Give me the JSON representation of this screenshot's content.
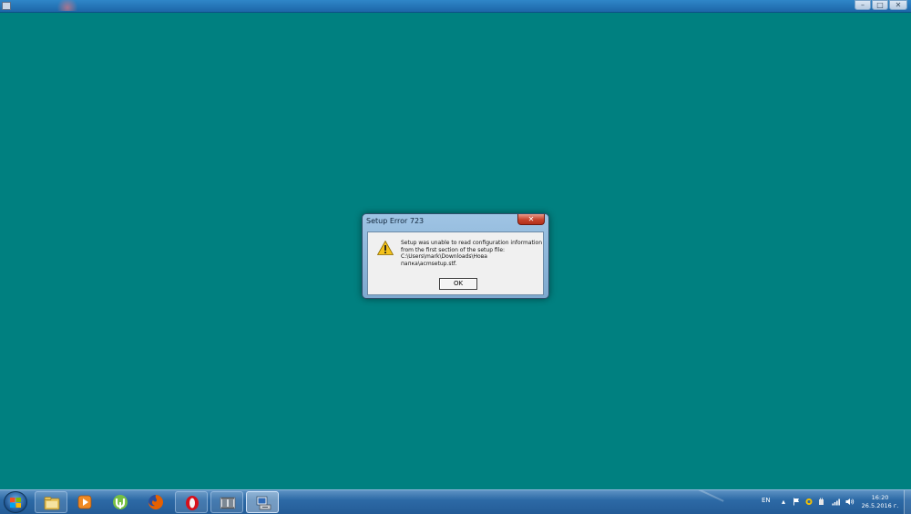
{
  "top_bar": {
    "controls": [
      "–",
      "□",
      "✕"
    ]
  },
  "dialog": {
    "title": "Setup Error 723",
    "close_label": "✕",
    "message_lines": [
      "Setup was unable to read configuration information",
      "from the first section of the setup file:",
      "C:\\Users\\mark\\Downloads\\Нова",
      "папка\\acmsetup.stf."
    ],
    "ok_label": "OK",
    "icon": "warning-icon"
  },
  "taskbar": {
    "apps": [
      {
        "name": "windows-explorer",
        "icon": "folder-icon"
      },
      {
        "name": "media-player",
        "icon": "play-icon"
      },
      {
        "name": "utorrent",
        "icon": "utorrent-icon"
      },
      {
        "name": "firefox",
        "icon": "firefox-icon"
      },
      {
        "name": "opera",
        "icon": "opera-icon"
      },
      {
        "name": "photo-viewer",
        "icon": "filmstrip-icon"
      },
      {
        "name": "setup-program",
        "icon": "setup-icon",
        "active": true
      }
    ],
    "language": "EN",
    "tray_icons": [
      "show-hidden-icon",
      "action-center-flag-icon",
      "update-icon",
      "power-icon",
      "network-icon",
      "volume-icon"
    ],
    "time": "16:20",
    "date": "26.5.2016 г."
  },
  "colors": {
    "desktop": "#008080",
    "taskbar": "#2d6aa6"
  }
}
